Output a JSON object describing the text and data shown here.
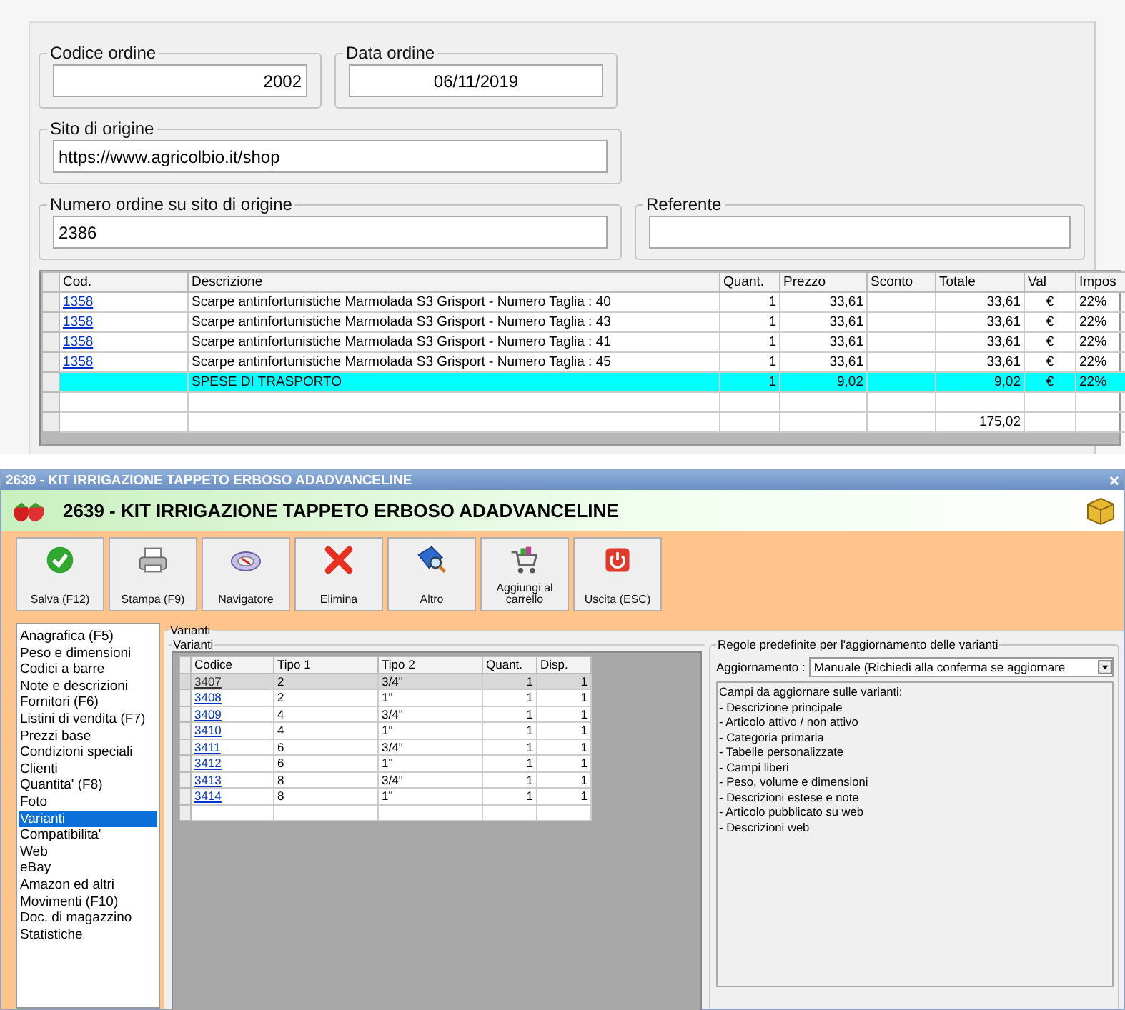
{
  "order": {
    "fields": [
      {
        "label": "Codice ordine",
        "value": "2002",
        "kind": "number"
      },
      {
        "label": "Data ordine",
        "value": "06/11/2019",
        "kind": "date"
      },
      {
        "label": "Sito di origine",
        "value": "https://www.agricolbio.it/shop",
        "kind": "text"
      },
      {
        "label": "Numero ordine su sito di origine",
        "value": "2386",
        "kind": "text"
      },
      {
        "label": "Referente",
        "kind": "text"
      }
    ],
    "table": {
      "columns": [
        "Cod.",
        "Descrizione",
        "Quant.",
        "Prezzo",
        "Sconto",
        "Totale",
        "Val",
        "Impos"
      ],
      "rows": [
        {
          "kind": "item",
          "cells": [
            "1358",
            "Scarpe antinfortunistiche Marmolada S3 Grisport - Numero Taglia : 40",
            "1",
            "33,61",
            "",
            "33,61",
            "€",
            "22%"
          ]
        },
        {
          "kind": "item",
          "cells": [
            "1358",
            "Scarpe antinfortunistiche Marmolada S3 Grisport - Numero Taglia : 43",
            "1",
            "33,61",
            "",
            "33,61",
            "€",
            "22%"
          ]
        },
        {
          "kind": "item",
          "cells": [
            "1358",
            "Scarpe antinfortunistiche Marmolada S3 Grisport - Numero Taglia : 41",
            "1",
            "33,61",
            "",
            "33,61",
            "€",
            "22%"
          ]
        },
        {
          "kind": "item",
          "cells": [
            "1358",
            "Scarpe antinfortunistiche Marmolada S3 Grisport - Numero Taglia : 45",
            "1",
            "33,61",
            "",
            "33,61",
            "€",
            "22%"
          ]
        },
        {
          "kind": "shipping",
          "cells": [
            "",
            "SPESE DI TRASPORTO",
            "1",
            "9,02",
            "",
            "9,02",
            "€",
            "22%"
          ]
        },
        {
          "kind": "blank",
          "cells": [
            "",
            "",
            "",
            "",
            "",
            "",
            "",
            ""
          ]
        },
        {
          "kind": "total",
          "cells": [
            "",
            "",
            "",
            "",
            "",
            "175,02",
            "",
            ""
          ]
        }
      ]
    }
  },
  "window": {
    "title": "2639 - KIT IRRIGAZIONE TAPPETO ERBOSO ADADVANCELINE",
    "header": "2639 - KIT IRRIGAZIONE TAPPETO ERBOSO ADADVANCELINE",
    "toolbar": [
      {
        "label": "Salva (F12)",
        "kind": "save"
      },
      {
        "label": "Stampa (F9)",
        "kind": "print"
      },
      {
        "label": "Navigatore",
        "kind": "navigator"
      },
      {
        "label": "Elimina",
        "kind": "delete"
      },
      {
        "label": "Altro",
        "kind": "more"
      },
      {
        "label": "Aggiungi al carrello",
        "kind": "cart"
      },
      {
        "label": "Uscita (ESC)",
        "kind": "exit"
      }
    ],
    "sidebar": {
      "items": [
        {
          "label": "Anagrafica (F5)",
          "selected": false
        },
        {
          "label": "Peso e dimensioni",
          "selected": false
        },
        {
          "label": "Codici a barre",
          "selected": false
        },
        {
          "label": "Note e descrizioni",
          "selected": false
        },
        {
          "label": "Fornitori (F6)",
          "selected": false
        },
        {
          "label": "Listini di vendita (F7)",
          "selected": false
        },
        {
          "label": "Prezzi base",
          "selected": false
        },
        {
          "label": "Condizioni speciali",
          "selected": false
        },
        {
          "label": "Clienti",
          "selected": false
        },
        {
          "label": "Quantita' (F8)",
          "selected": false
        },
        {
          "label": "Foto",
          "selected": false
        },
        {
          "label": "Varianti",
          "selected": true
        },
        {
          "label": "Compatibilita'",
          "selected": false
        },
        {
          "label": "Web",
          "selected": false
        },
        {
          "label": "eBay",
          "selected": false
        },
        {
          "label": "Amazon ed altri",
          "selected": false
        },
        {
          "label": "Movimenti (F10)",
          "selected": false
        },
        {
          "label": "Doc. di magazzino",
          "selected": false
        },
        {
          "label": "Statistiche",
          "selected": false
        }
      ]
    },
    "variants": {
      "title": "Varianti",
      "group_title": "Varianti",
      "columns": [
        "Codice",
        "Tipo 1",
        "Tipo 2",
        "Quant.",
        "Disp."
      ],
      "rows": [
        {
          "cells": [
            "3407",
            "2",
            "3/4\"",
            "1",
            "1"
          ],
          "selected": true
        },
        {
          "cells": [
            "3408",
            "2",
            "1\"",
            "1",
            "1"
          ],
          "selected": false
        },
        {
          "cells": [
            "3409",
            "4",
            "3/4\"",
            "1",
            "1"
          ],
          "selected": false
        },
        {
          "cells": [
            "3410",
            "4",
            "1\"",
            "1",
            "1"
          ],
          "selected": false
        },
        {
          "cells": [
            "3411",
            "6",
            "3/4\"",
            "1",
            "1"
          ],
          "selected": false
        },
        {
          "cells": [
            "3412",
            "6",
            "1\"",
            "1",
            "1"
          ],
          "selected": false
        },
        {
          "cells": [
            "3413",
            "8",
            "3/4\"",
            "1",
            "1"
          ],
          "selected": false
        },
        {
          "cells": [
            "3414",
            "8",
            "1\"",
            "1",
            "1"
          ],
          "selected": false
        }
      ]
    },
    "rules": {
      "title": "Regole predefinite per l'aggiornamento delle varianti",
      "select_label": "Aggiornamento :",
      "select_value": "Manuale (Richiedi alla conferma se aggiornare",
      "fields_text": "Campi da aggiornare sulle varianti:\n- Descrizione principale\n- Articolo attivo / non attivo\n- Categoria primaria\n- Tabelle personalizzate\n- Campi liberi\n- Peso, volume e dimensioni\n- Descrizioni estese e note\n- Articolo pubblicato su web\n- Descrizioni web"
    }
  }
}
